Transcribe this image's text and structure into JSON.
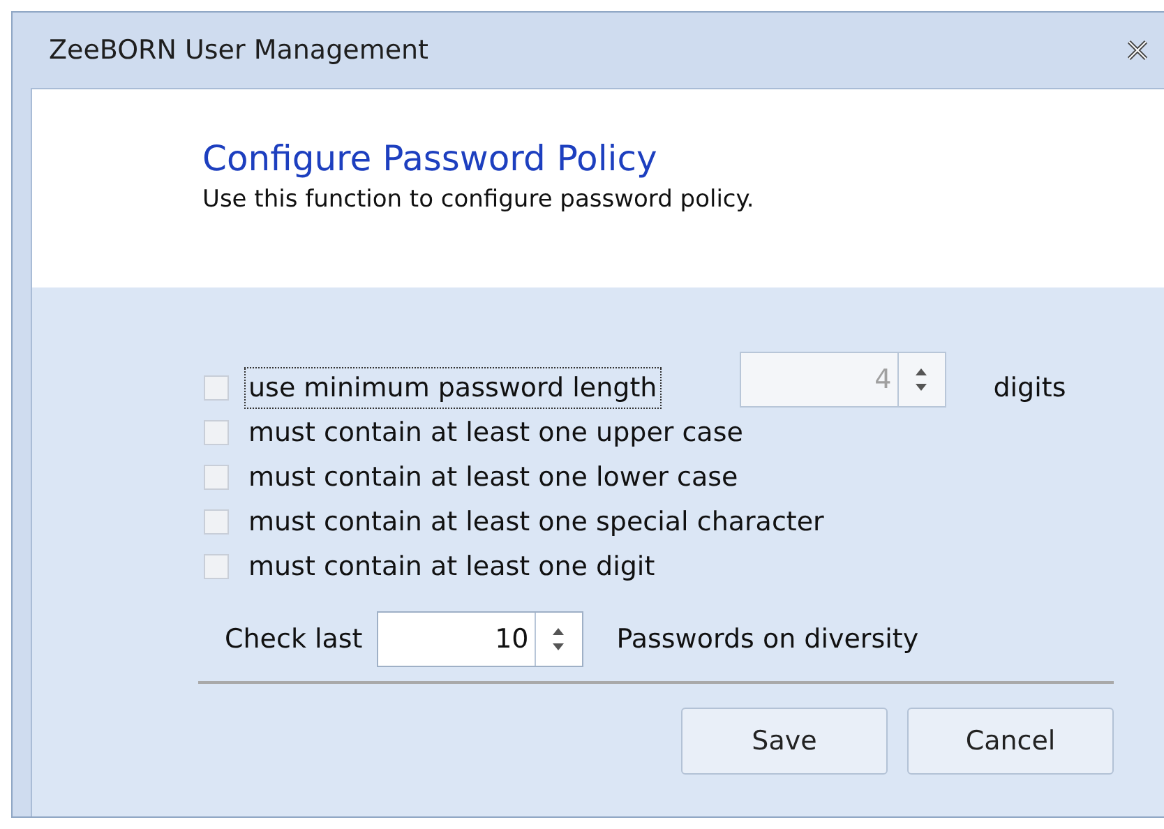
{
  "window": {
    "title": "ZeeBORN User Management"
  },
  "header": {
    "title": "Configure Password Policy",
    "description": "Use this function to configure password policy."
  },
  "options": [
    {
      "label": "use minimum password length",
      "checked": false,
      "focused": true
    },
    {
      "label": "must contain at least one upper case",
      "checked": false,
      "focused": false
    },
    {
      "label": "must contain at least one lower case",
      "checked": false,
      "focused": false
    },
    {
      "label": "must contain at least one special character",
      "checked": false,
      "focused": false
    },
    {
      "label": "must contain at least one digit",
      "checked": false,
      "focused": false
    }
  ],
  "min_length": {
    "value": "4",
    "disabled": true,
    "unit": "digits"
  },
  "history": {
    "label": "Check last",
    "value": "10",
    "disabled": false,
    "suffix": "Passwords on diversity"
  },
  "buttons": [
    "Save",
    "Cancel"
  ]
}
